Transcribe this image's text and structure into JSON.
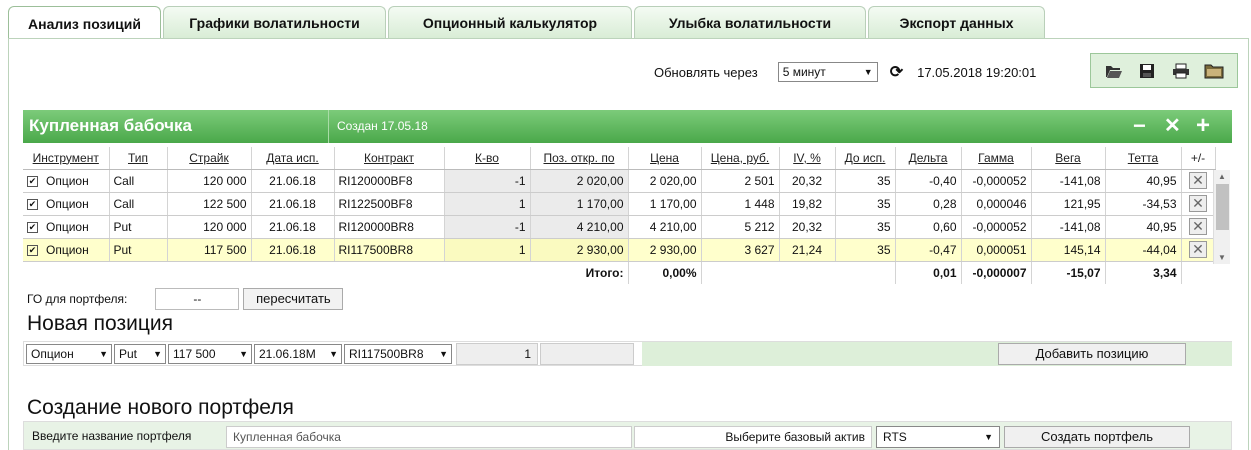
{
  "tabs": [
    {
      "label": "Анализ позиций",
      "active": true
    },
    {
      "label": "Графики волатильности"
    },
    {
      "label": "Опционный калькулятор"
    },
    {
      "label": "Улыбка волатильности"
    },
    {
      "label": "Экспорт данных"
    }
  ],
  "toolbar": {
    "refresh_label": "Обновлять через",
    "refresh_value": "5 минут",
    "datetime": "17.05.2018 19:20:01",
    "icons": [
      "open-folder-icon",
      "save-icon",
      "print-icon",
      "folder-icon"
    ]
  },
  "portfolio": {
    "name": "Купленная бабочка",
    "created": "Создан 17.05.18",
    "title_buttons": [
      "−",
      "✕",
      "+"
    ]
  },
  "columns": [
    "Инструмент",
    "Тип",
    "Страйк",
    "Дата исп.",
    "Контракт",
    "К-во",
    "Поз. откр. по",
    "Цена",
    "Цена, руб.",
    "IV, %",
    "До исп.",
    "Дельта",
    "Гамма",
    "Вега",
    "Тетта",
    "+/-"
  ],
  "rows": [
    [
      "Опцион",
      "Call",
      "120 000",
      "21.06.18",
      "RI120000BF8",
      "-1",
      "2 020,00",
      "2 020,00",
      "2 501",
      "20,32",
      "35",
      "-0,40",
      "-0,000052",
      "-141,08",
      "40,95"
    ],
    [
      "Опцион",
      "Call",
      "122 500",
      "21.06.18",
      "RI122500BF8",
      "1",
      "1 170,00",
      "1 170,00",
      "1 448",
      "19,82",
      "35",
      "0,28",
      "0,000046",
      "121,95",
      "-34,53"
    ],
    [
      "Опцион",
      "Put",
      "120 000",
      "21.06.18",
      "RI120000BR8",
      "-1",
      "4 210,00",
      "4 210,00",
      "5 212",
      "20,32",
      "35",
      "0,60",
      "-0,000052",
      "-141,08",
      "40,95"
    ],
    [
      "Опцион",
      "Put",
      "117 500",
      "21.06.18",
      "RI117500BR8",
      "1",
      "2 930,00",
      "2 930,00",
      "3 627",
      "21,24",
      "35",
      "-0,47",
      "0,000051",
      "145,14",
      "-44,04"
    ]
  ],
  "highlight_row": 3,
  "totals": {
    "label": "Итого:",
    "price": "0,00%",
    "delta": "0,01",
    "gamma": "-0,000007",
    "vega": "-15,07",
    "theta": "3,34"
  },
  "margin": {
    "label": "ГО для портфеля:",
    "value": "--",
    "button": "пересчитать"
  },
  "new_position": {
    "heading": "Новая позиция",
    "instrument": "Опцион",
    "type": "Put",
    "strike": "117 500",
    "date": "21.06.18M",
    "contract": "RI117500BR8",
    "quantity": "1",
    "add_button": "Добавить позицию"
  },
  "create_portfolio": {
    "heading": "Создание нового портфеля",
    "name_label": "Введите название портфеля",
    "name_value": "Купленная бабочка",
    "asset_label": "Выберите базовый актив",
    "asset_value": "RTS",
    "create_button": "Создать портфель"
  },
  "colors": {
    "accent_green": "#4aa84a",
    "highlight_row": "#ffffcc",
    "tab_bg": "#d8ecd5"
  }
}
